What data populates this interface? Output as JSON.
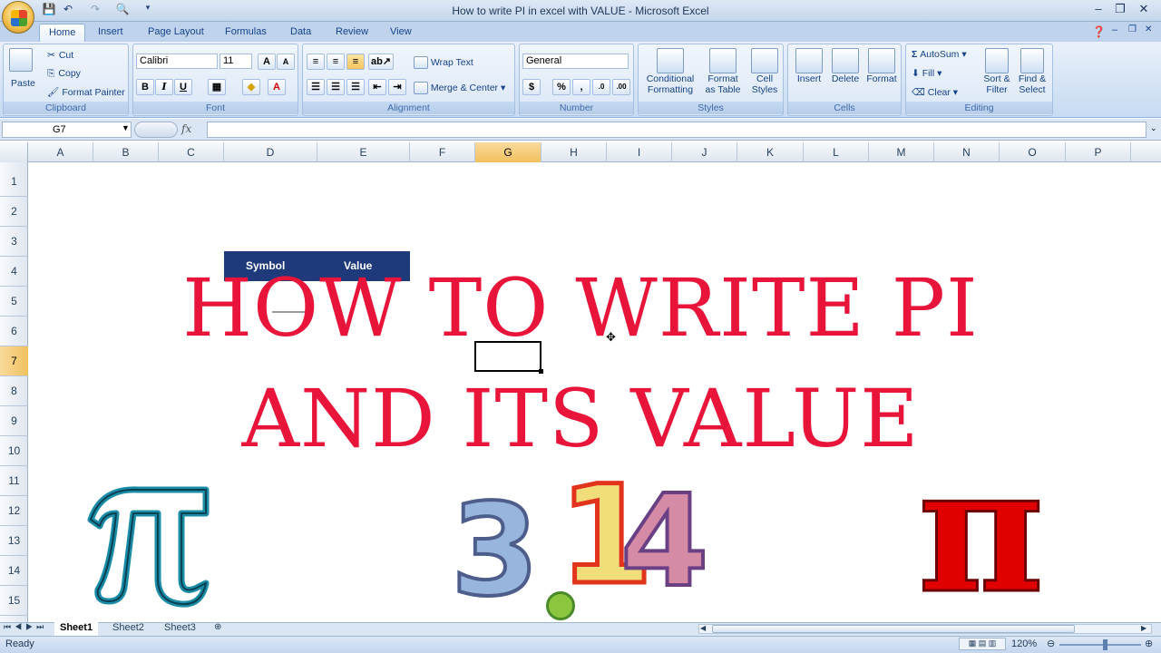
{
  "window": {
    "title": "How to write PI in excel with VALUE - Microsoft Excel"
  },
  "ribbon": {
    "tabs": [
      {
        "label": "Home",
        "active": true
      },
      {
        "label": "Insert"
      },
      {
        "label": "Page Layout"
      },
      {
        "label": "Formulas"
      },
      {
        "label": "Data"
      },
      {
        "label": "Review"
      },
      {
        "label": "View"
      }
    ],
    "clipboard": {
      "paste": "Paste",
      "cut": "Cut",
      "copy": "Copy",
      "format_painter": "Format Painter",
      "label": "Clipboard"
    },
    "font": {
      "name": "Calibri",
      "size": "11",
      "label": "Font"
    },
    "alignment": {
      "wrap_text": "Wrap Text",
      "merge_center": "Merge & Center",
      "label": "Alignment"
    },
    "number": {
      "format": "General",
      "label": "Number"
    },
    "styles": {
      "conditional_line1": "Conditional",
      "conditional_line2": "Formatting",
      "format_table_line1": "Format",
      "format_table_line2": "as Table",
      "cell_styles_line1": "Cell",
      "cell_styles_line2": "Styles",
      "label": "Styles"
    },
    "cells": {
      "insert": "Insert",
      "delete": "Delete",
      "format": "Format",
      "label": "Cells"
    },
    "editing": {
      "autosum": "AutoSum",
      "fill": "Fill",
      "clear": "Clear",
      "sort_line1": "Sort &",
      "sort_line2": "Filter",
      "find_line1": "Find &",
      "find_line2": "Select",
      "label": "Editing"
    }
  },
  "formula_bar": {
    "name_box": "G7",
    "fx": "fx",
    "formula": ""
  },
  "grid": {
    "columns": [
      "A",
      "B",
      "C",
      "D",
      "E",
      "F",
      "G",
      "H",
      "I",
      "J",
      "K",
      "L",
      "M",
      "N",
      "O",
      "P"
    ],
    "rows": [
      "1",
      "2",
      "3",
      "4",
      "5",
      "6",
      "7",
      "8",
      "9",
      "10",
      "11",
      "12",
      "13",
      "14",
      "15"
    ],
    "selected_column": "G",
    "selected_row": "7",
    "table_headers": [
      "Symbol",
      "Value"
    ]
  },
  "overlay": {
    "line1": "HOW TO WRITE PI",
    "line2": "AND ITS VALUE",
    "number_digits": [
      "3",
      ".",
      "1",
      "4"
    ],
    "pi_symbol": "π",
    "text_color": "#e8143a"
  },
  "sheets": {
    "tabs": [
      "Sheet1",
      "Sheet2",
      "Sheet3"
    ],
    "active": "Sheet1"
  },
  "status": {
    "text": "Ready",
    "zoom": "120%"
  }
}
